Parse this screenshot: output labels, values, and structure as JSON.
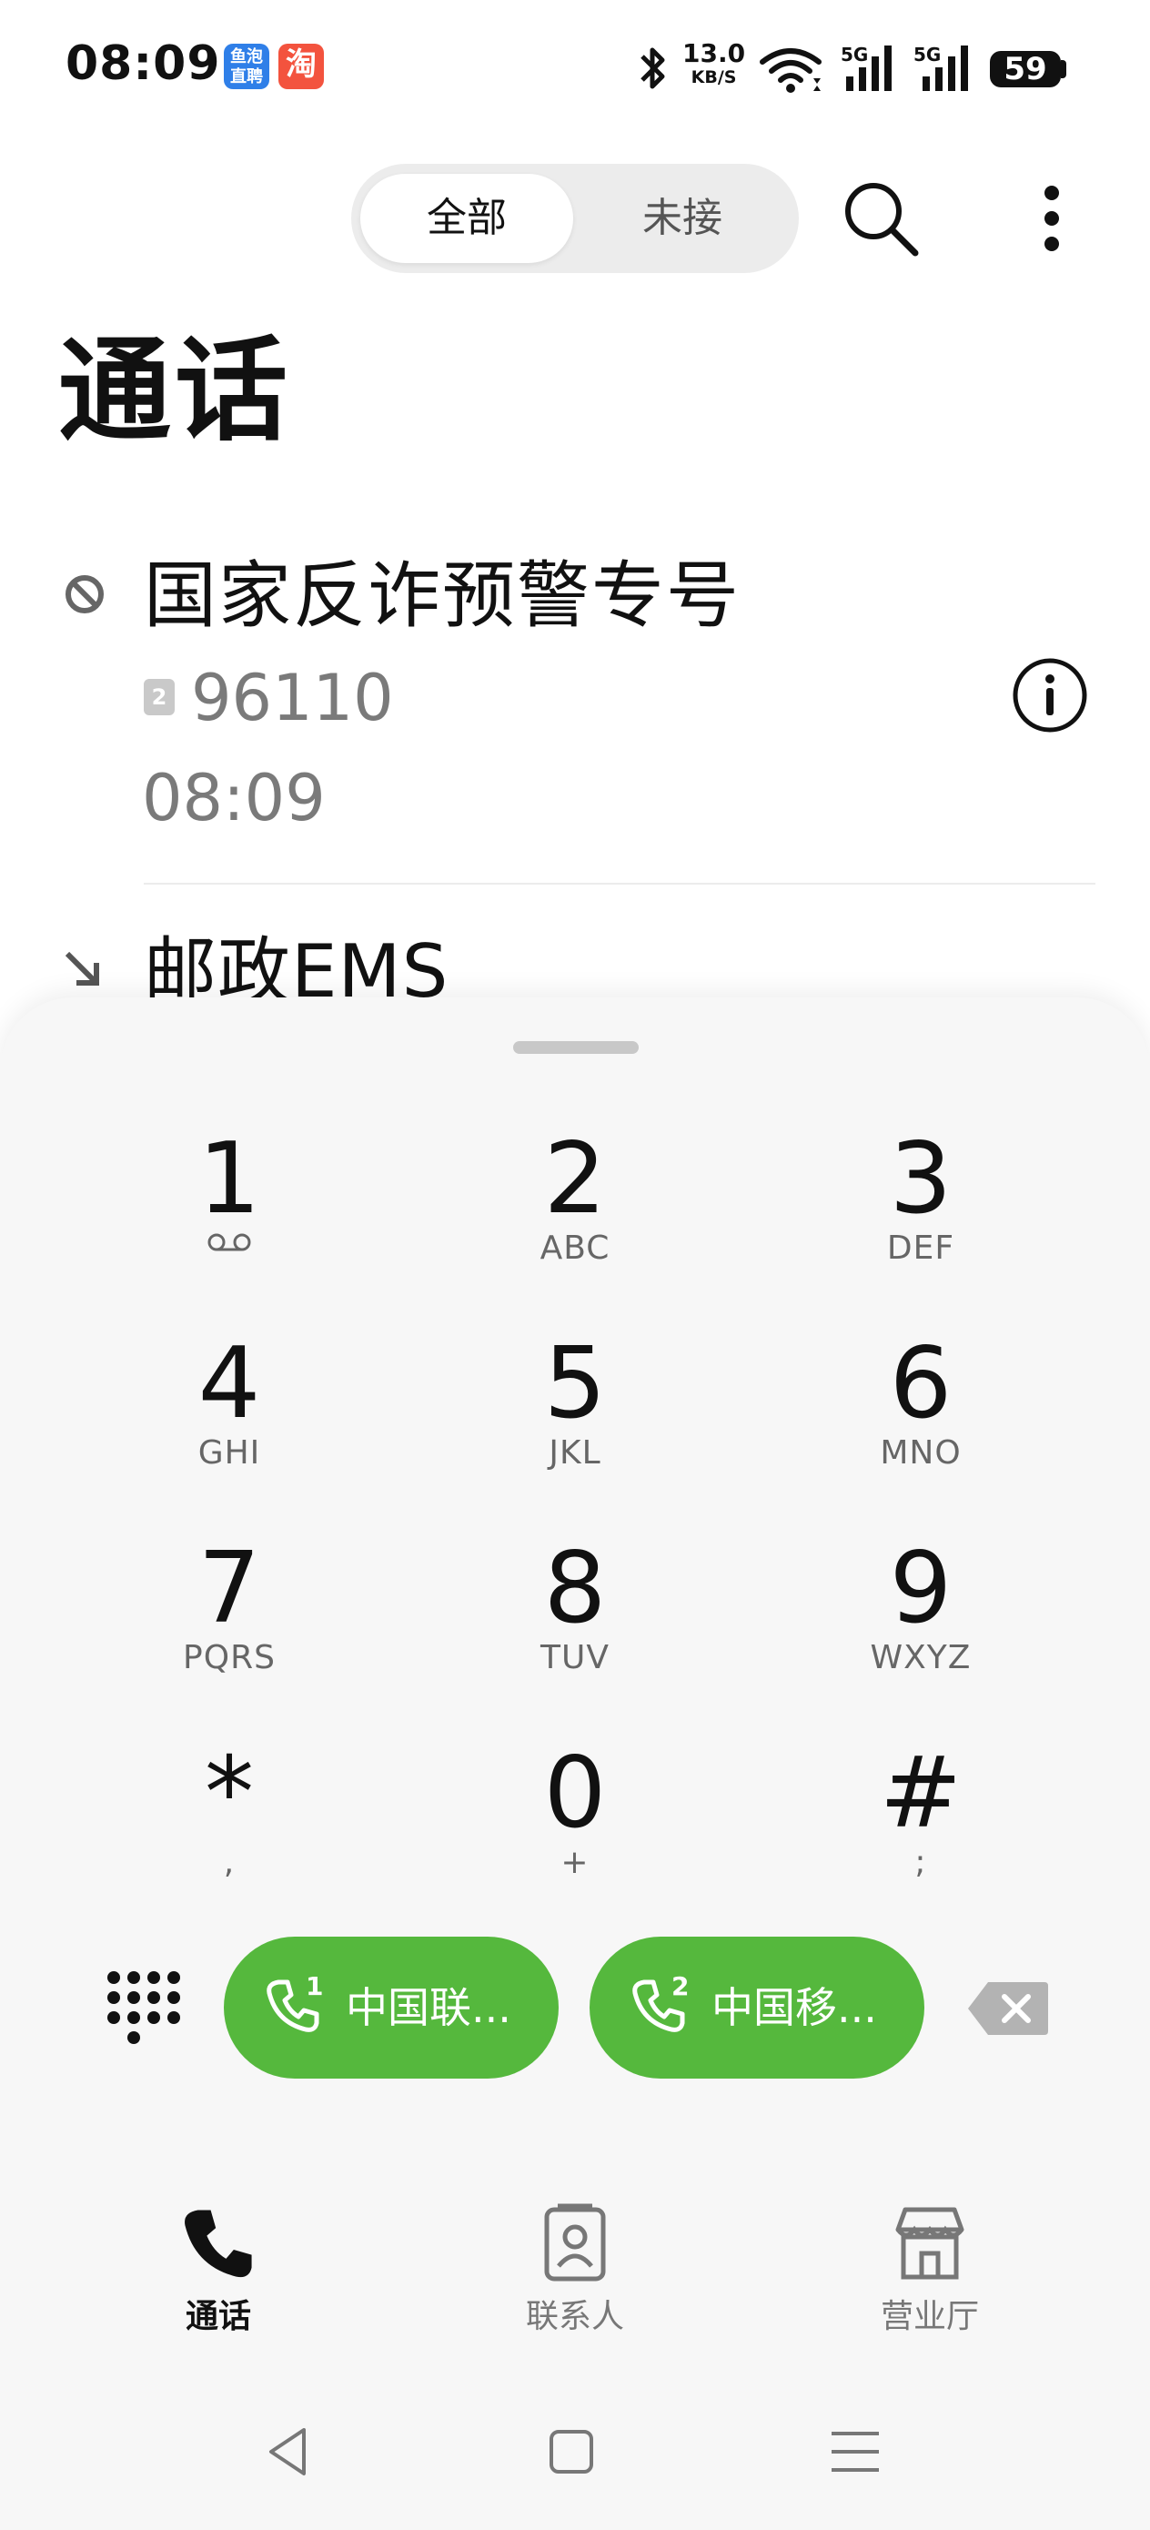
{
  "status_bar": {
    "time": "08:09",
    "app_badges": [
      {
        "name": "鱼泡直聘",
        "line1": "鱼泡",
        "line2": "直聘"
      },
      {
        "name": "淘",
        "glyph": "淘"
      }
    ],
    "net_speed_value": "13.0",
    "net_speed_unit": "KB/S",
    "signal_label_1": "5G",
    "signal_label_2": "5G",
    "battery": "59"
  },
  "header": {
    "filter_tabs": [
      {
        "label": "全部",
        "selected": true
      },
      {
        "label": "未接",
        "selected": false
      }
    ],
    "title": "通话"
  },
  "calls": [
    {
      "name": "国家反诈预警专号",
      "sim": "2",
      "number": "96110",
      "time": "08:09",
      "type": "blocked"
    },
    {
      "name": "邮政EMS",
      "type": "incoming"
    }
  ],
  "dialpad": {
    "keys": [
      {
        "digit": "1",
        "letters": ""
      },
      {
        "digit": "2",
        "letters": "ABC"
      },
      {
        "digit": "3",
        "letters": "DEF"
      },
      {
        "digit": "4",
        "letters": "GHI"
      },
      {
        "digit": "5",
        "letters": "JKL"
      },
      {
        "digit": "6",
        "letters": "MNO"
      },
      {
        "digit": "7",
        "letters": "PQRS"
      },
      {
        "digit": "8",
        "letters": "TUV"
      },
      {
        "digit": "9",
        "letters": "WXYZ"
      },
      {
        "digit": "*",
        "letters": ","
      },
      {
        "digit": "0",
        "letters": "+"
      },
      {
        "digit": "#",
        "letters": ";"
      }
    ],
    "call_buttons": [
      {
        "sim": "1",
        "label": "中国联..."
      },
      {
        "sim": "2",
        "label": "中国移..."
      }
    ]
  },
  "bottom_nav": [
    {
      "label": "通话",
      "icon": "phone-icon",
      "active": true
    },
    {
      "label": "联系人",
      "icon": "contacts-icon",
      "active": false
    },
    {
      "label": "营业厅",
      "icon": "store-icon",
      "active": false
    }
  ],
  "colors": {
    "accent_green": "#55b83d",
    "sheet_bg": "#f7f7f7",
    "secondary_text": "#7a7a7a"
  }
}
